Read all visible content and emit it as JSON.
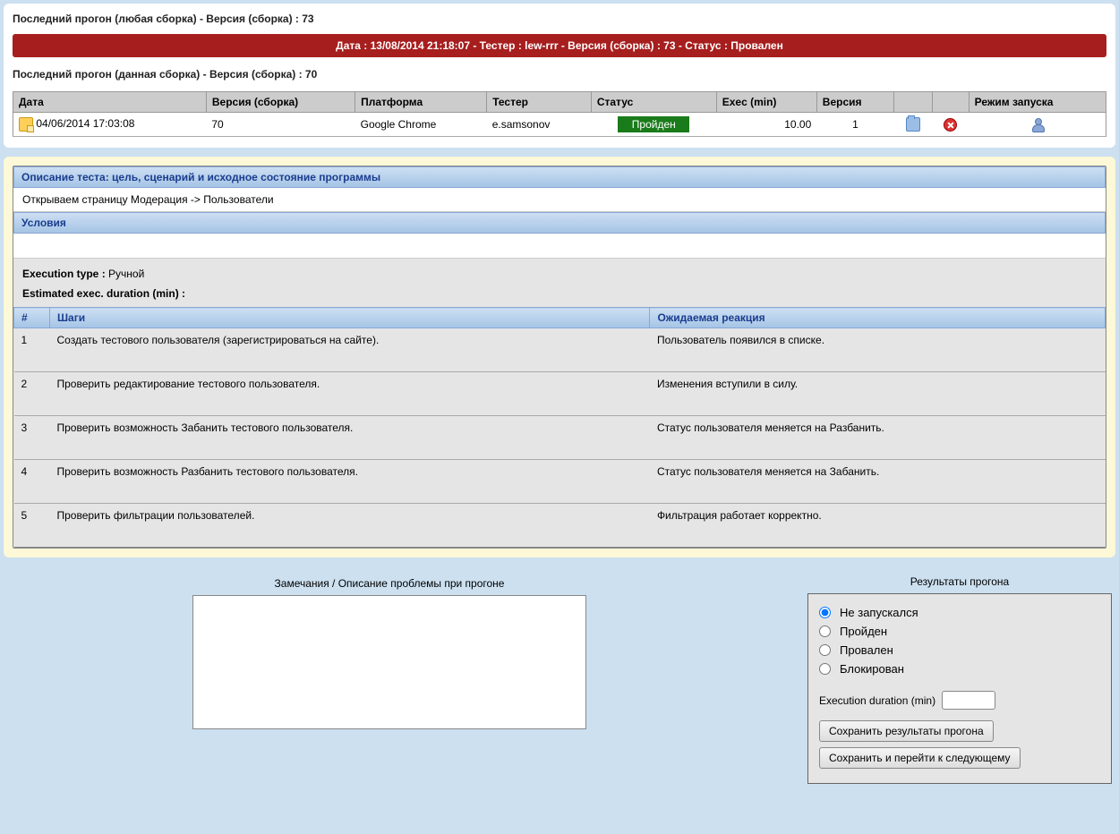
{
  "lastRunAny": {
    "title": "Последний прогон (любая сборка) - Версия (сборка) : 73",
    "bar": "Дата : 13/08/2014 21:18:07 - Тестер : lew-rrr - Версия (сборка) : 73 - Статус : Провален"
  },
  "lastRunThis": {
    "title": "Последний прогон (данная сборка) - Версия (сборка) : 70",
    "headers": {
      "date": "Дата",
      "build": "Версия (сборка)",
      "platform": "Платформа",
      "tester": "Тестер",
      "status": "Статус",
      "exec": "Exec (min)",
      "version": "Версия",
      "mode": "Режим запуска"
    },
    "row": {
      "date": "04/06/2014 17:03:08",
      "build": "70",
      "platform": "Google Chrome",
      "tester": "e.samsonov",
      "status": "Пройден",
      "exec": "10.00",
      "version": "1"
    }
  },
  "desc": {
    "header": "Описание теста: цель, сценарий и исходное состояние программы",
    "body": "Открываем страницу Модерация -> Пользователи"
  },
  "conditions": {
    "header": "Условия"
  },
  "exec": {
    "type_label": "Execution type :",
    "type_value": "Ручной",
    "dur_label": "Estimated exec. duration (min) :",
    "dur_value": ""
  },
  "stepsHeaders": {
    "num": "#",
    "step": "Шаги",
    "expected": "Ожидаемая реакция"
  },
  "steps": [
    {
      "n": "1",
      "step": "Создать тестового пользователя (зарегистрироваться на сайте).",
      "exp": "Пользователь появился в списке."
    },
    {
      "n": "2",
      "step": "Проверить редактирование тестового пользователя.",
      "exp": "Изменения вступили в силу."
    },
    {
      "n": "3",
      "step": "Проверить возможность Забанить тестового пользователя.",
      "exp": "Статус пользователя меняется на Разбанить."
    },
    {
      "n": "4",
      "step": "Проверить возможность Разбанить тестового пользователя.",
      "exp": "Статус пользователя меняется на Забанить."
    },
    {
      "n": "5",
      "step": "Проверить фильтрации пользователей.",
      "exp": "Фильтрация работает корректно."
    }
  ],
  "notes": {
    "label": "Замечания / Описание проблемы при прогоне"
  },
  "results": {
    "title": "Результаты прогона",
    "options": {
      "not_run": "Не запускался",
      "passed": "Пройден",
      "failed": "Провален",
      "blocked": "Блокирован"
    },
    "dur_label": "Execution duration (min)",
    "btn_save": "Сохранить результаты прогона",
    "btn_next": "Сохранить и перейти к следующему"
  }
}
